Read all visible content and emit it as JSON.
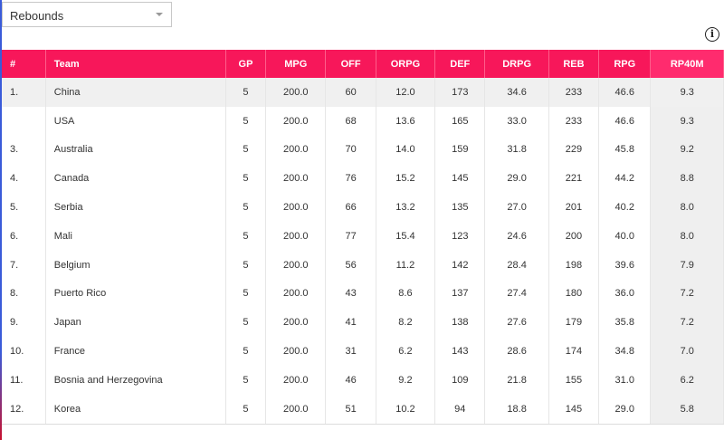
{
  "selector": {
    "value": "Rebounds",
    "icon": "chevron-down-icon"
  },
  "info": {
    "glyph": "i",
    "icon": "info-icon"
  },
  "table": {
    "columns": [
      "#",
      "Team",
      "GP",
      "MPG",
      "OFF",
      "ORPG",
      "DEF",
      "DRPG",
      "REB",
      "RPG",
      "RP40M"
    ],
    "highlight_row": 0,
    "rows": [
      [
        "1.",
        "China",
        "5",
        "200.0",
        "60",
        "12.0",
        "173",
        "34.6",
        "233",
        "46.6",
        "9.3"
      ],
      [
        "",
        "USA",
        "5",
        "200.0",
        "68",
        "13.6",
        "165",
        "33.0",
        "233",
        "46.6",
        "9.3"
      ],
      [
        "3.",
        "Australia",
        "5",
        "200.0",
        "70",
        "14.0",
        "159",
        "31.8",
        "229",
        "45.8",
        "9.2"
      ],
      [
        "4.",
        "Canada",
        "5",
        "200.0",
        "76",
        "15.2",
        "145",
        "29.0",
        "221",
        "44.2",
        "8.8"
      ],
      [
        "5.",
        "Serbia",
        "5",
        "200.0",
        "66",
        "13.2",
        "135",
        "27.0",
        "201",
        "40.2",
        "8.0"
      ],
      [
        "6.",
        "Mali",
        "5",
        "200.0",
        "77",
        "15.4",
        "123",
        "24.6",
        "200",
        "40.0",
        "8.0"
      ],
      [
        "7.",
        "Belgium",
        "5",
        "200.0",
        "56",
        "11.2",
        "142",
        "28.4",
        "198",
        "39.6",
        "7.9"
      ],
      [
        "8.",
        "Puerto Rico",
        "5",
        "200.0",
        "43",
        "8.6",
        "137",
        "27.4",
        "180",
        "36.0",
        "7.2"
      ],
      [
        "9.",
        "Japan",
        "5",
        "200.0",
        "41",
        "8.2",
        "138",
        "27.6",
        "179",
        "35.8",
        "7.2"
      ],
      [
        "10.",
        "France",
        "5",
        "200.0",
        "31",
        "6.2",
        "143",
        "28.6",
        "174",
        "34.8",
        "7.0"
      ],
      [
        "11.",
        "Bosnia and Herzegovina",
        "5",
        "200.0",
        "46",
        "9.2",
        "109",
        "21.8",
        "155",
        "31.0",
        "6.2"
      ],
      [
        "12.",
        "Korea",
        "5",
        "200.0",
        "51",
        "10.2",
        "94",
        "18.8",
        "145",
        "29.0",
        "5.8"
      ]
    ]
  },
  "colors": {
    "header": "#f7175a",
    "highlight": "#f0f0f0",
    "sort_column": "#efefef"
  }
}
